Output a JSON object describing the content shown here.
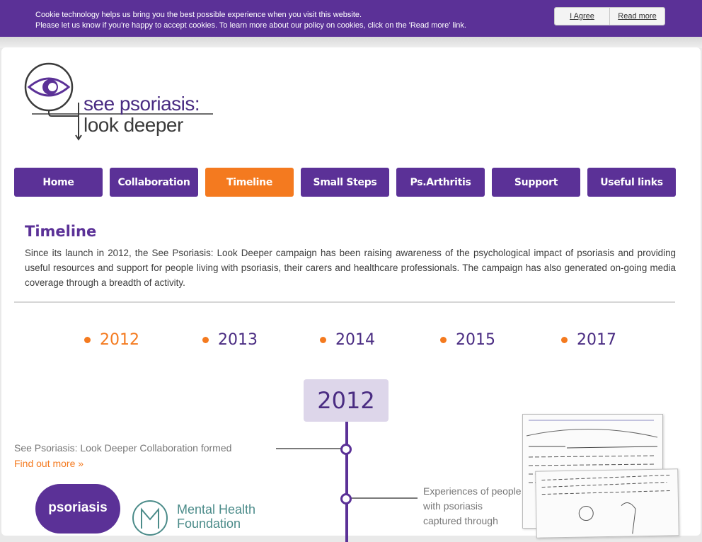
{
  "cookie": {
    "line1": "Cookie technology helps us bring you the best possible experience when you visit this website.",
    "line2": "Please let us know if you're happy to accept cookies. To learn more about our policy on cookies, click on the 'Read more' link.",
    "agree_label": "I Agree",
    "read_more_label": "Read more"
  },
  "logo": {
    "line1": "see psoriasis:",
    "line2": "look deeper"
  },
  "nav": {
    "items": [
      {
        "label": "Home"
      },
      {
        "label": "Collaboration"
      },
      {
        "label": "Timeline"
      },
      {
        "label": "Small Steps"
      },
      {
        "label": "Ps.Arthritis"
      },
      {
        "label": "Support"
      },
      {
        "label": "Useful links"
      }
    ],
    "active": "Timeline"
  },
  "content": {
    "title": "Timeline",
    "intro": "Since its launch in 2012, the See Psoriasis: Look Deeper campaign has been raising awareness of the psychological impact of psoriasis and providing useful resources and support for people living with psoriasis, their carers and healthcare professionals. The campaign has also generated on-going media coverage through a breadth of activity."
  },
  "years": {
    "items": [
      "2012",
      "2013",
      "2014",
      "2015",
      "2017"
    ],
    "active": "2012"
  },
  "timeline": {
    "current_year": "2012",
    "event1_text": "See Psoriasis: Look Deeper Collaboration formed",
    "event1_link": "Find out more »",
    "event2_text": "Experiences of people with psoriasis captured through"
  },
  "partner_logos": {
    "psoriasis": "psoriasis",
    "mhf_line1": "Mental Health",
    "mhf_line2": "Foundation"
  },
  "colors": {
    "purple": "#5b3197",
    "orange": "#f47a1f",
    "year_box": "#ddd6ea"
  }
}
